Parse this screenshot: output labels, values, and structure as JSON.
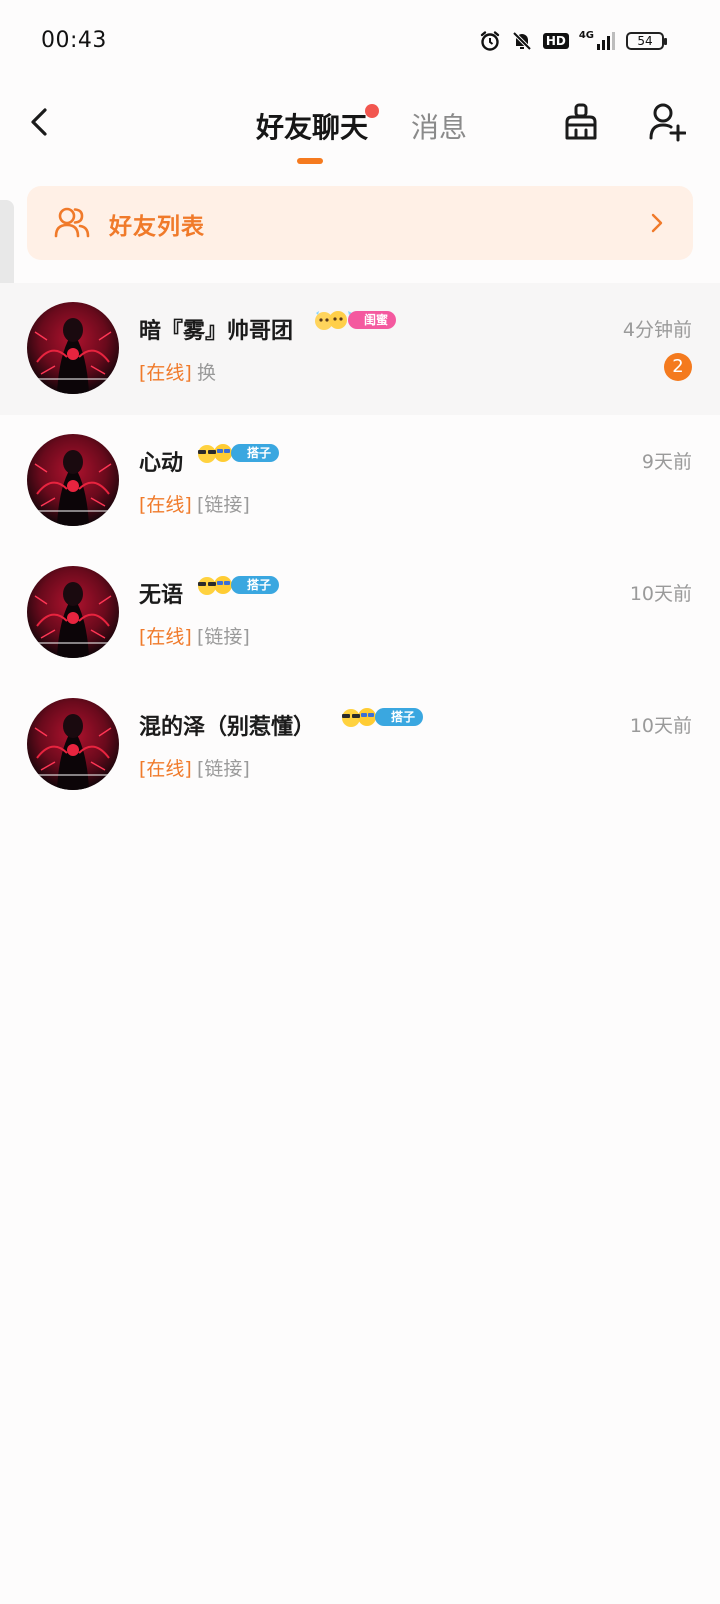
{
  "status_bar": {
    "time": "00:43",
    "icons": [
      "alarm-icon",
      "mute-bell-icon",
      "hd-icon",
      "4g-signal-icon",
      "battery-icon"
    ],
    "hd_label": "HD",
    "network_label": "4G",
    "battery": "54"
  },
  "header": {
    "back_icon": "chevron-left-icon",
    "tabs": [
      {
        "label": "好友聊天",
        "active": true,
        "has_dot": true
      },
      {
        "label": "消息",
        "active": false
      }
    ],
    "clean_icon": "broom-icon",
    "add_friend_icon": "add-user-icon"
  },
  "banner": {
    "icon": "friends-icon",
    "label": "好友列表",
    "chevron": "chevron-right-icon"
  },
  "chats": [
    {
      "name": "暗『雾』帅哥团",
      "badge": "闺蜜",
      "badge_color": "#f4599f",
      "time": "4分钟前",
      "status": "[在线]",
      "preview": "换",
      "unread": "2",
      "highlight": true
    },
    {
      "name": "心动",
      "badge": "搭子",
      "badge_color": "#3aa7e0",
      "time": "9天前",
      "status": "[在线]",
      "preview": "[链接]",
      "unread": null,
      "highlight": false
    },
    {
      "name": "无语",
      "badge": "搭子",
      "badge_color": "#3aa7e0",
      "time": "10天前",
      "status": "[在线]",
      "preview": "[链接]",
      "unread": null,
      "highlight": false
    },
    {
      "name": "混的泽（别惹懂）",
      "badge": "搭子",
      "badge_color": "#3aa7e0",
      "time": "10天前",
      "status": "[在线]",
      "preview": "[链接]",
      "unread": null,
      "highlight": false
    }
  ],
  "colors": {
    "accent": "#f57a1f",
    "tab_dot": "#f2564f",
    "banner_bg": "#fff0e6",
    "status_online": "#f07a2a",
    "muted_text": "#9a9a9a"
  }
}
